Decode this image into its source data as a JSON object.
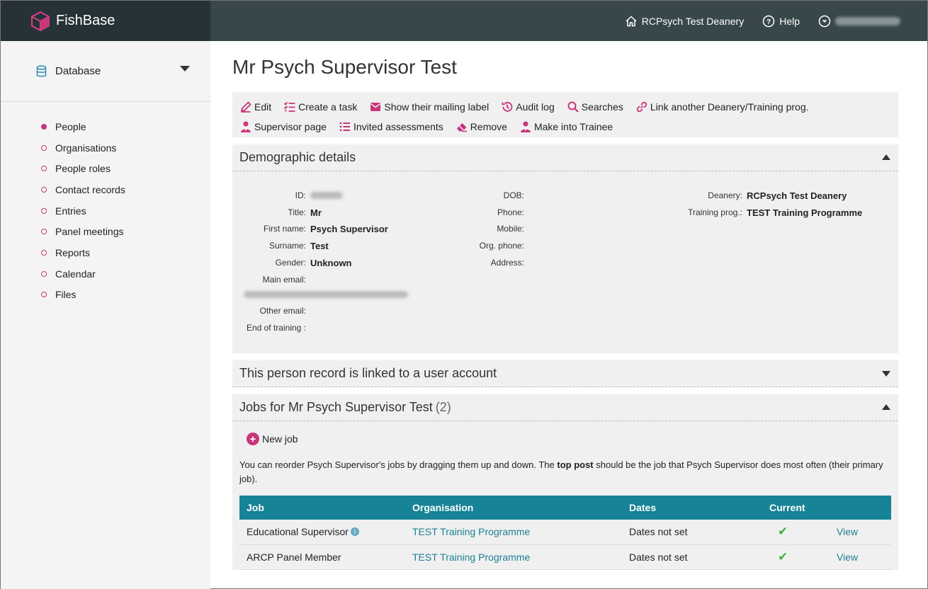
{
  "app": {
    "name": "FishBase"
  },
  "topnav": {
    "deanery": "RCPsych Test Deanery",
    "help": "Help"
  },
  "sidebar": {
    "database_label": "Database",
    "items": [
      {
        "label": "People",
        "active": true
      },
      {
        "label": "Organisations"
      },
      {
        "label": "People roles"
      },
      {
        "label": "Contact records"
      },
      {
        "label": "Entries"
      },
      {
        "label": "Panel meetings"
      },
      {
        "label": "Reports"
      },
      {
        "label": "Calendar"
      },
      {
        "label": "Files"
      }
    ]
  },
  "page": {
    "title": "Mr Psych Supervisor Test"
  },
  "actions": {
    "edit": "Edit",
    "create_task": "Create a task",
    "mailing_label": "Show their mailing label",
    "audit_log": "Audit log",
    "searches": "Searches",
    "link_deanery": "Link another Deanery/Training prog.",
    "supervisor_page": "Supervisor page",
    "invited_assessments": "Invited assessments",
    "remove": "Remove",
    "make_trainee": "Make into Trainee"
  },
  "demographic": {
    "heading": "Demographic details",
    "labels": {
      "id": "ID:",
      "title": "Title:",
      "first_name": "First name:",
      "surname": "Surname:",
      "gender": "Gender:",
      "main_email": "Main email:",
      "other_email": "Other email:",
      "end_training": "End of training :",
      "dob": "DOB:",
      "phone": "Phone:",
      "mobile": "Mobile:",
      "org_phone": "Org. phone:",
      "address": "Address:",
      "deanery": "Deanery:",
      "training_prog": "Training prog.:"
    },
    "values": {
      "title": "Mr",
      "first_name": "Psych Supervisor",
      "surname": "Test",
      "gender": "Unknown",
      "deanery": "RCPsych Test Deanery",
      "training_prog": "TEST Training Programme"
    }
  },
  "linked": {
    "heading": "This person record is linked to a user account"
  },
  "jobs": {
    "heading": "Jobs for Mr Psych Supervisor Test",
    "count": "(2)",
    "new_job": "New job",
    "info_before": "You can reorder Psych Supervisor's jobs by dragging them up and down. The ",
    "info_bold": "top post",
    "info_after": " should be the job that Psych Supervisor does most often (their primary job).",
    "columns": {
      "job": "Job",
      "organisation": "Organisation",
      "dates": "Dates",
      "current": "Current"
    },
    "rows": [
      {
        "job": "Educational Supervisor",
        "organisation": "TEST Training Programme",
        "dates": "Dates not set",
        "current": "✔",
        "action": "View"
      },
      {
        "job": "ARCP Panel Member",
        "organisation": "TEST Training Programme",
        "dates": "Dates not set",
        "current": "✔",
        "action": "View"
      }
    ]
  },
  "colors": {
    "brand": "#c7357b",
    "teal": "#178396",
    "topbar": "#37474a"
  }
}
